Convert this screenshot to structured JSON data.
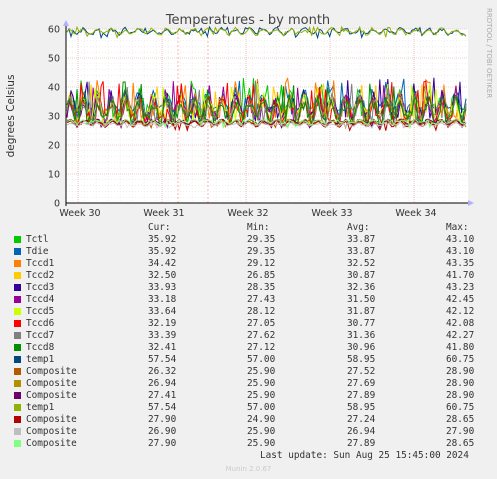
{
  "chart_data": {
    "type": "line",
    "title": "Temperatures - by month",
    "ylabel": "degrees Celsius",
    "side_label": "RRDTOOL / TOBI OETIKER",
    "ylim": [
      0,
      60
    ],
    "yticks": [
      0,
      10,
      20,
      30,
      40,
      50,
      60
    ],
    "x_ticks": [
      "Week 30",
      "Week 31",
      "Week 32",
      "Week 33",
      "Week 34"
    ],
    "grid": true,
    "legend_headers": {
      "cur": "Cur:",
      "min": "Min:",
      "avg": "Avg:",
      "max": "Max:"
    },
    "series": [
      {
        "name": "Tctl",
        "color": "#00cc00",
        "cur": "35.92",
        "min": "29.35",
        "avg": "33.87",
        "max": "43.10"
      },
      {
        "name": "Tdie",
        "color": "#0066b3",
        "cur": "35.92",
        "min": "29.35",
        "avg": "33.87",
        "max": "43.10"
      },
      {
        "name": "Tccd1",
        "color": "#ff8000",
        "cur": "34.42",
        "min": "29.12",
        "avg": "32.52",
        "max": "43.35"
      },
      {
        "name": "Tccd2",
        "color": "#ffcc00",
        "cur": "32.50",
        "min": "26.85",
        "avg": "30.87",
        "max": "41.70"
      },
      {
        "name": "Tccd3",
        "color": "#330099",
        "cur": "33.93",
        "min": "28.35",
        "avg": "32.36",
        "max": "43.23"
      },
      {
        "name": "Tccd4",
        "color": "#990099",
        "cur": "33.18",
        "min": "27.43",
        "avg": "31.50",
        "max": "42.45"
      },
      {
        "name": "Tccd5",
        "color": "#ccff00",
        "cur": "33.64",
        "min": "28.12",
        "avg": "31.87",
        "max": "42.12"
      },
      {
        "name": "Tccd6",
        "color": "#ff0000",
        "cur": "32.19",
        "min": "27.05",
        "avg": "30.77",
        "max": "42.08"
      },
      {
        "name": "Tccd7",
        "color": "#808080",
        "cur": "33.39",
        "min": "27.62",
        "avg": "31.36",
        "max": "42.27"
      },
      {
        "name": "Tccd8",
        "color": "#008f00",
        "cur": "32.41",
        "min": "27.12",
        "avg": "30.96",
        "max": "41.80"
      },
      {
        "name": "temp1",
        "color": "#00487d",
        "cur": "57.54",
        "min": "57.00",
        "avg": "58.95",
        "max": "60.75"
      },
      {
        "name": "Composite",
        "color": "#b35a00",
        "cur": "26.32",
        "min": "25.90",
        "avg": "27.52",
        "max": "28.90"
      },
      {
        "name": "Composite",
        "color": "#b38f00",
        "cur": "26.94",
        "min": "25.90",
        "avg": "27.69",
        "max": "28.90"
      },
      {
        "name": "Composite",
        "color": "#6b006b",
        "cur": "27.41",
        "min": "25.90",
        "avg": "27.89",
        "max": "28.90"
      },
      {
        "name": "temp1",
        "color": "#8fb300",
        "cur": "57.54",
        "min": "57.00",
        "avg": "58.95",
        "max": "60.75"
      },
      {
        "name": "Composite",
        "color": "#b30000",
        "cur": "27.90",
        "min": "24.90",
        "avg": "27.24",
        "max": "28.65"
      },
      {
        "name": "Composite",
        "color": "#bebebe",
        "cur": "26.90",
        "min": "25.90",
        "avg": "26.94",
        "max": "27.90"
      },
      {
        "name": "Composite",
        "color": "#80ff80",
        "cur": "27.90",
        "min": "25.90",
        "avg": "27.89",
        "max": "28.65"
      }
    ]
  },
  "footer": {
    "last_update": "Last update: Sun Aug 25 15:45:00 2024",
    "munin": "Munin 2.0.67"
  }
}
